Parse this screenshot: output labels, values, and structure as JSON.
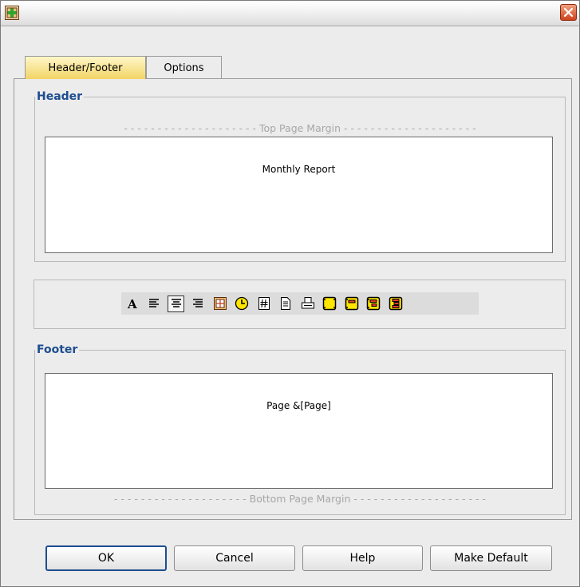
{
  "window": {
    "title": ""
  },
  "tabs": [
    {
      "label": "Header/Footer",
      "active": true
    },
    {
      "label": "Options",
      "active": false
    }
  ],
  "header": {
    "legend": "Header",
    "margin_label": "- - - - - - - - - - - - - - - - - - - - Top Page Margin - - - - - - - - - - - - - - - - - - - -",
    "text": "Monthly Report"
  },
  "toolbar": {
    "icons": [
      "font-icon",
      "align-left-icon",
      "align-center-icon",
      "align-right-icon",
      "insert-date-icon",
      "insert-time-icon",
      "insert-page-number-icon",
      "insert-page-count-icon",
      "insert-print-icon",
      "insert-field-icon",
      "insert-group-icon",
      "insert-outline-icon",
      "insert-section-icon"
    ]
  },
  "footer": {
    "legend": "Footer",
    "text": "Page &[Page]",
    "margin_label": "- - - - - - - - - - - - - - - - - - - - Bottom Page Margin - - - - - - - - - - - - - - - - - - - -"
  },
  "buttons": {
    "ok": "OK",
    "cancel": "Cancel",
    "help": "Help",
    "make_default": "Make Default"
  },
  "colors": {
    "accent": "#1d4d8f",
    "tab_active": "#f2d466",
    "close": "#d0421c",
    "icon_yellow": "#ffe600"
  }
}
